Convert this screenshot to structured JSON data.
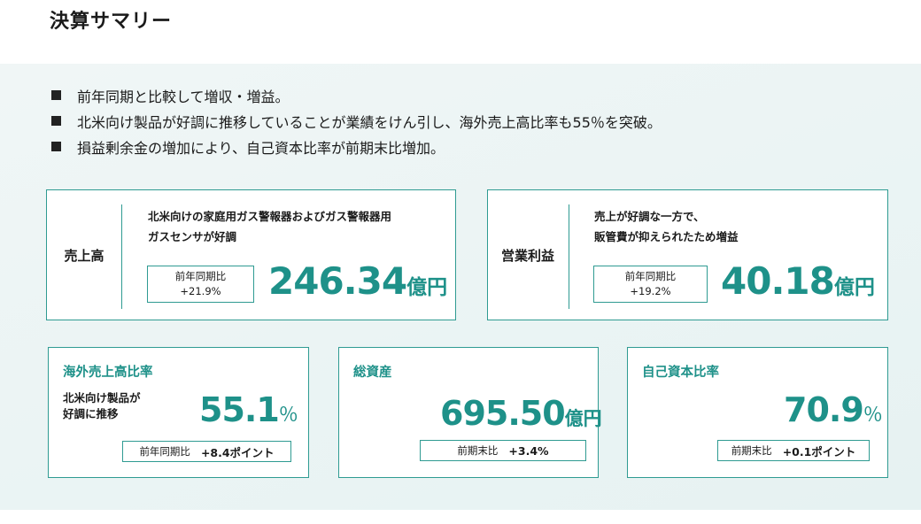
{
  "page": {
    "title": "決算サマリー"
  },
  "bullets": [
    "前年同期と比較して増収・増益。",
    "北米向け製品が好調に推移していることが業績をけん引し、海外売上高比率も55％を突破。",
    "損益剰余金の増加により、自己資本比率が前期末比増加。"
  ],
  "sales": {
    "label": "売上高",
    "desc_line1": "北米向けの家庭用ガス警報器およびガス警報器用",
    "desc_line2": "ガスセンサが好調",
    "yoy_label": "前年同期比",
    "yoy_value": "+21.9%",
    "value": "246.34",
    "unit": "億円"
  },
  "operating_income": {
    "label": "営業利益",
    "desc_line1": "売上が好調な一方で、",
    "desc_line2": "販管費が抑えられたため増益",
    "yoy_label": "前年同期比",
    "yoy_value": "+19.2%",
    "value": "40.18",
    "unit": "億円"
  },
  "overseas_ratio": {
    "title": "海外売上高比率",
    "note_line1": "北米向け製品が",
    "note_line2": "好調に推移",
    "value": "55.1",
    "unit": "％",
    "cmp_label": "前年同期比",
    "cmp_value": "+8.4ポイント"
  },
  "total_assets": {
    "title": "総資産",
    "value": "695.50",
    "unit": "億円",
    "cmp_label": "前期末比",
    "cmp_value": "+3.4%"
  },
  "equity_ratio": {
    "title": "自己資本比率",
    "value": "70.9",
    "unit": "％",
    "cmp_label": "前期末比",
    "cmp_value": "+0.1ポイント"
  },
  "colors": {
    "accent": "#1e9189",
    "border": "#2f9b92",
    "panel": "#e8f3f3"
  }
}
